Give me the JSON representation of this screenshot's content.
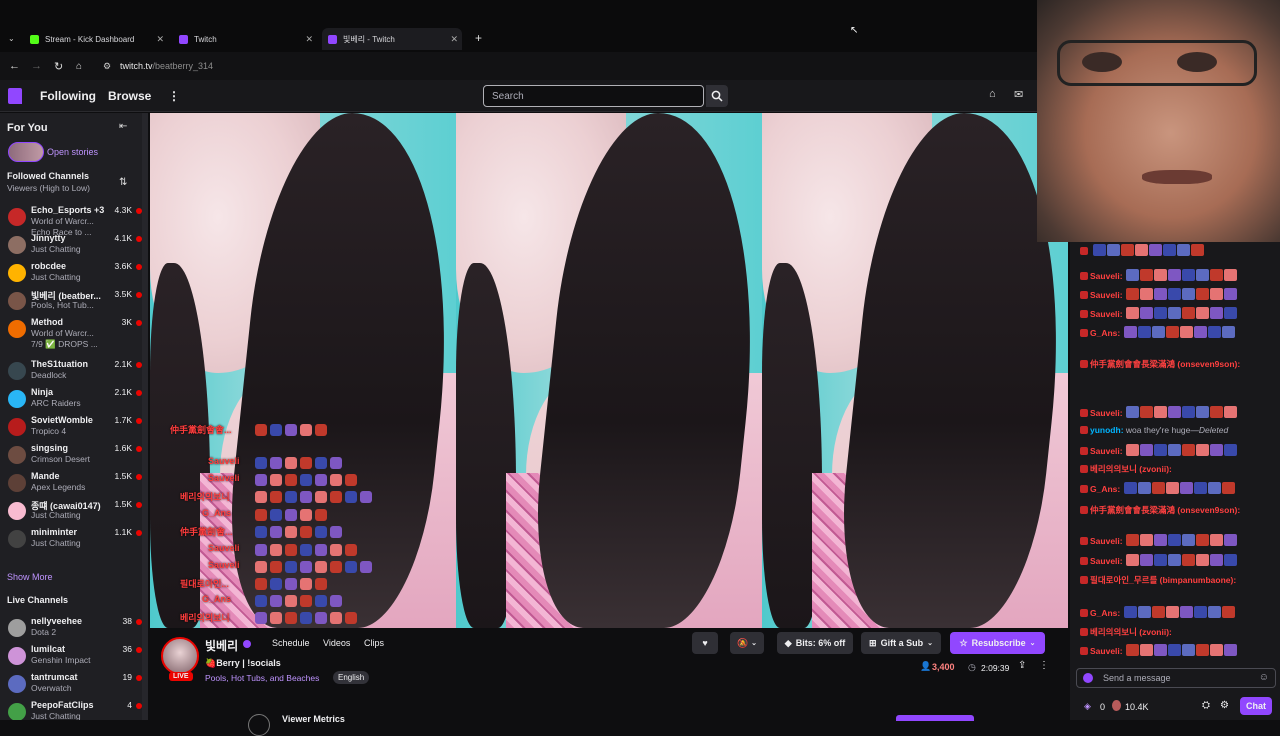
{
  "browser": {
    "tabs": [
      {
        "label": "Stream - Kick Dashboard",
        "color": "#53fc18"
      },
      {
        "label": "Twitch",
        "color": "#9146ff"
      },
      {
        "label": "빛베리 - Twitch",
        "color": "#9146ff"
      }
    ],
    "url_host": "twitch.tv",
    "url_path": "/beatberry_314"
  },
  "topnav": {
    "following": "Following",
    "browse": "Browse",
    "search_placeholder": "Search"
  },
  "sidebar": {
    "for_you": "For You",
    "open_stories": "Open stories",
    "followed_title": "Followed Channels",
    "followed_sort": "Viewers (High to Low)",
    "followed": [
      {
        "name": "Echo_Esports +3",
        "game": "World of Warcr...",
        "game2": "Echo Race to ...",
        "viewers": "4.3K",
        "color": "#c62828"
      },
      {
        "name": "Jinnytty",
        "game": "Just Chatting",
        "viewers": "4.1K",
        "color": "#8d6e63"
      },
      {
        "name": "robcdee",
        "game": "Just Chatting",
        "viewers": "3.6K",
        "color": "#ffb300"
      },
      {
        "name": "빛베리 (beatber...",
        "game": "Pools, Hot Tub...",
        "viewers": "3.5K",
        "color": "#795548"
      },
      {
        "name": "Method",
        "game": "World of Warcr...",
        "game2": "7/9 ✅ DROPS ...",
        "viewers": "3K",
        "color": "#ef6c00"
      },
      {
        "name": "TheS1tuation",
        "game": "Deadlock",
        "viewers": "2.1K",
        "color": "#37474f"
      },
      {
        "name": "Ninja",
        "game": "ARC Raiders",
        "viewers": "2.1K",
        "color": "#29b6f6"
      },
      {
        "name": "SovietWomble",
        "game": "Tropico 4",
        "viewers": "1.7K",
        "color": "#b71c1c"
      },
      {
        "name": "singsing",
        "game": "Crimson Desert",
        "viewers": "1.6K",
        "color": "#6d4c41"
      },
      {
        "name": "Mande",
        "game": "Apex Legends",
        "viewers": "1.5K",
        "color": "#5d4037"
      },
      {
        "name": "종떄 (cawai0147)",
        "game": "Just Chatting",
        "viewers": "1.5K",
        "color": "#f8bbd0"
      },
      {
        "name": "miniminter",
        "game": "Just Chatting",
        "viewers": "1.1K",
        "color": "#424242"
      }
    ],
    "show_more": "Show More",
    "live_title": "Live Channels",
    "live": [
      {
        "name": "nellyveehee",
        "game": "Dota 2",
        "viewers": "38",
        "color": "#9e9e9e"
      },
      {
        "name": "lumilcat",
        "game": "Genshin Impact",
        "viewers": "36",
        "color": "#ce93d8"
      },
      {
        "name": "tantrumcat",
        "game": "Overwatch",
        "viewers": "19",
        "color": "#5c6bc0"
      },
      {
        "name": "PeepoFatClips",
        "game": "Just Chatting",
        "viewers": "4",
        "color": "#43a047"
      }
    ]
  },
  "overlay_chat": [
    {
      "user": "仲手黨劍會會..."
    },
    {
      "user": "Sauveli"
    },
    {
      "user": "Sauveli"
    },
    {
      "user": "베리의의보니"
    },
    {
      "user": "G_Ans"
    },
    {
      "user": "仲手黨劍會..."
    },
    {
      "user": "Sauveli"
    },
    {
      "user": "Sauveli"
    },
    {
      "user": "필대로아인..."
    },
    {
      "user": "G_Ans"
    },
    {
      "user": "베리의의보니"
    }
  ],
  "stream": {
    "channel": "빛베리",
    "title": "🍓Berry | !socials",
    "category": "Pools, Hot Tubs, and Beaches",
    "language": "English",
    "tabs": [
      "Schedule",
      "Videos",
      "Clips"
    ],
    "live_badge": "LIVE",
    "bits": "Bits: 6% off",
    "gift": "Gift a Sub",
    "resub": "Resubscribe",
    "viewers": "3,400",
    "uptime": "2:09:39",
    "metrics": "Viewer Metrics"
  },
  "chat": {
    "messages": [
      {
        "user": "",
        "text": "",
        "color": "#00c853"
      },
      {
        "user": "Sauveli:",
        "text": "",
        "color": "#ff4040"
      },
      {
        "user": "Sauveli:",
        "text": "",
        "color": "#ff4040"
      },
      {
        "user": "Sauveli:",
        "text": "",
        "color": "#ff4040"
      },
      {
        "user": "G_Ans:",
        "text": "",
        "color": "#ff4040"
      },
      {
        "user": "仲手黨劍會會長梁滿鴻 (onseven9son):",
        "text": "",
        "color": "#ff4040"
      },
      {
        "user": "Sauveli:",
        "text": "",
        "color": "#ff4040"
      },
      {
        "user": "yunodh:",
        "text": "woa they're huge",
        "deleted": "—Deleted",
        "color": "#00b5ff"
      },
      {
        "user": "Sauveli:",
        "text": "",
        "color": "#ff4040"
      },
      {
        "user": "베리의의보니 (zvonii):",
        "text": "",
        "color": "#ff4040"
      },
      {
        "user": "G_Ans:",
        "text": "",
        "color": "#ff4040"
      },
      {
        "user": "仲手黨劍會會長梁滿鴻 (onseven9son):",
        "text": "",
        "color": "#ff4040"
      },
      {
        "user": "Sauveli:",
        "text": "",
        "color": "#ff4040"
      },
      {
        "user": "Sauveli:",
        "text": "",
        "color": "#ff4040"
      },
      {
        "user": "필대로아인_무르를 (bimpanumbaone):",
        "text": "",
        "color": "#ff4040"
      },
      {
        "user": "G_Ans:",
        "text": "",
        "color": "#ff4040"
      },
      {
        "user": "베리의의보니 (zvonii):",
        "text": "",
        "color": "#ff4040"
      },
      {
        "user": "Sauveli:",
        "text": "",
        "color": "#ff4040"
      }
    ],
    "input_placeholder": "Send a message",
    "points_left": "0",
    "points": "10.4K",
    "chat_button": "Chat"
  },
  "colors": {
    "accent": "#9147ff",
    "live": "#eb0400",
    "username_red": "#ff4040"
  }
}
